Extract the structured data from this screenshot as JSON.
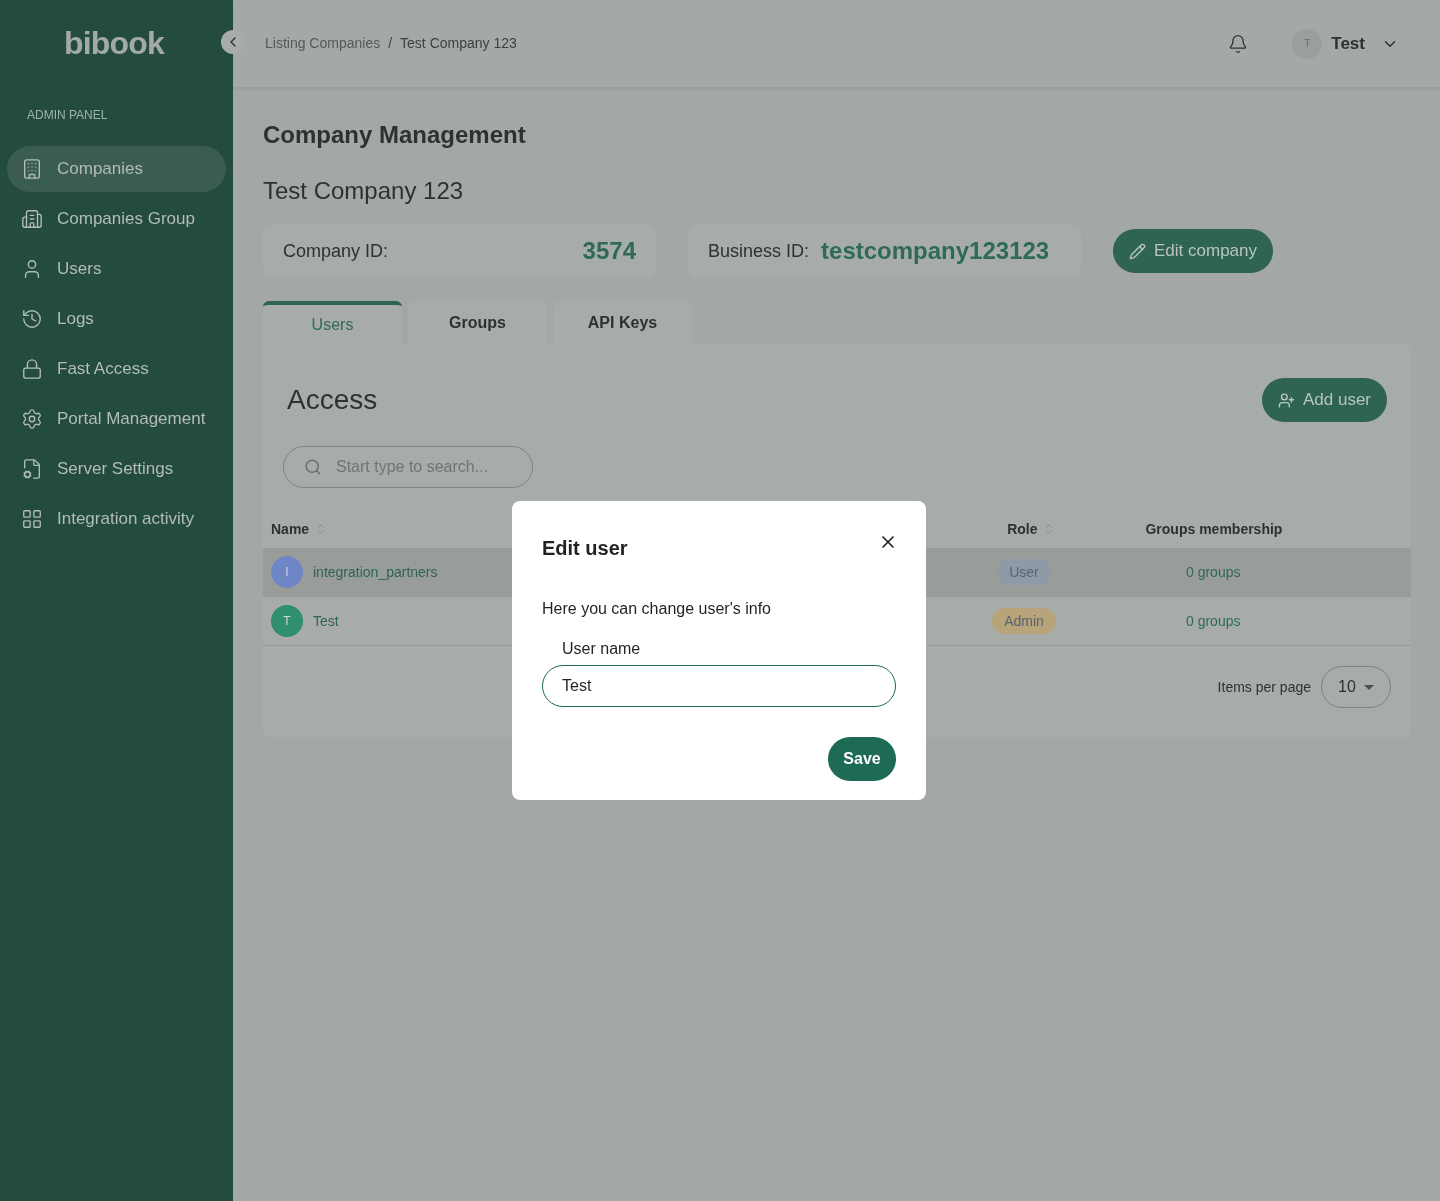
{
  "sidebar": {
    "logo": "bibook",
    "section": "ADMIN PANEL",
    "items": [
      {
        "label": "Companies",
        "selected": true
      },
      {
        "label": "Companies Group",
        "selected": false
      },
      {
        "label": "Users",
        "selected": false
      },
      {
        "label": "Logs",
        "selected": false
      },
      {
        "label": "Fast Access",
        "selected": false
      },
      {
        "label": "Portal Management",
        "selected": false
      },
      {
        "label": "Server Settings",
        "selected": false
      },
      {
        "label": "Integration activity",
        "selected": false
      }
    ]
  },
  "header": {
    "breadcrumbs": [
      "Listing Companies",
      "/",
      "Test Company 123"
    ],
    "user": {
      "initial": "T",
      "name": "Test"
    }
  },
  "page": {
    "title": "Company Management",
    "company_name": "Test Company 123",
    "company_id": {
      "label": "Company ID:",
      "value": "3574"
    },
    "business_id": {
      "label": "Business ID:",
      "value": "testcompany123123"
    },
    "edit_button": "Edit company"
  },
  "tabs": [
    {
      "label": "Users",
      "selected": true
    },
    {
      "label": "Groups",
      "selected": false
    },
    {
      "label": "API Keys",
      "selected": false
    }
  ],
  "access": {
    "title": "Access",
    "add_button": "Add user",
    "search": {
      "placeholder": "Start type to search..."
    },
    "columns": [
      "Name",
      "Role",
      "Groups membership"
    ],
    "rows": [
      {
        "initial": "I",
        "name": "integration_partners",
        "role": "User",
        "color": "#8e9aa6",
        "groups": "0 groups",
        "selected": true
      },
      {
        "initial": "T",
        "name": "Test",
        "role": "Admin",
        "color": "#b8a47a",
        "groups": "0 groups",
        "selected": false
      }
    ],
    "pagination": {
      "label": "Items per page",
      "value": "10"
    }
  },
  "dialog": {
    "title": "Edit user",
    "description": "Here you can change user's info",
    "field_label": "User name",
    "field_value": "Test",
    "save": "Save"
  }
}
